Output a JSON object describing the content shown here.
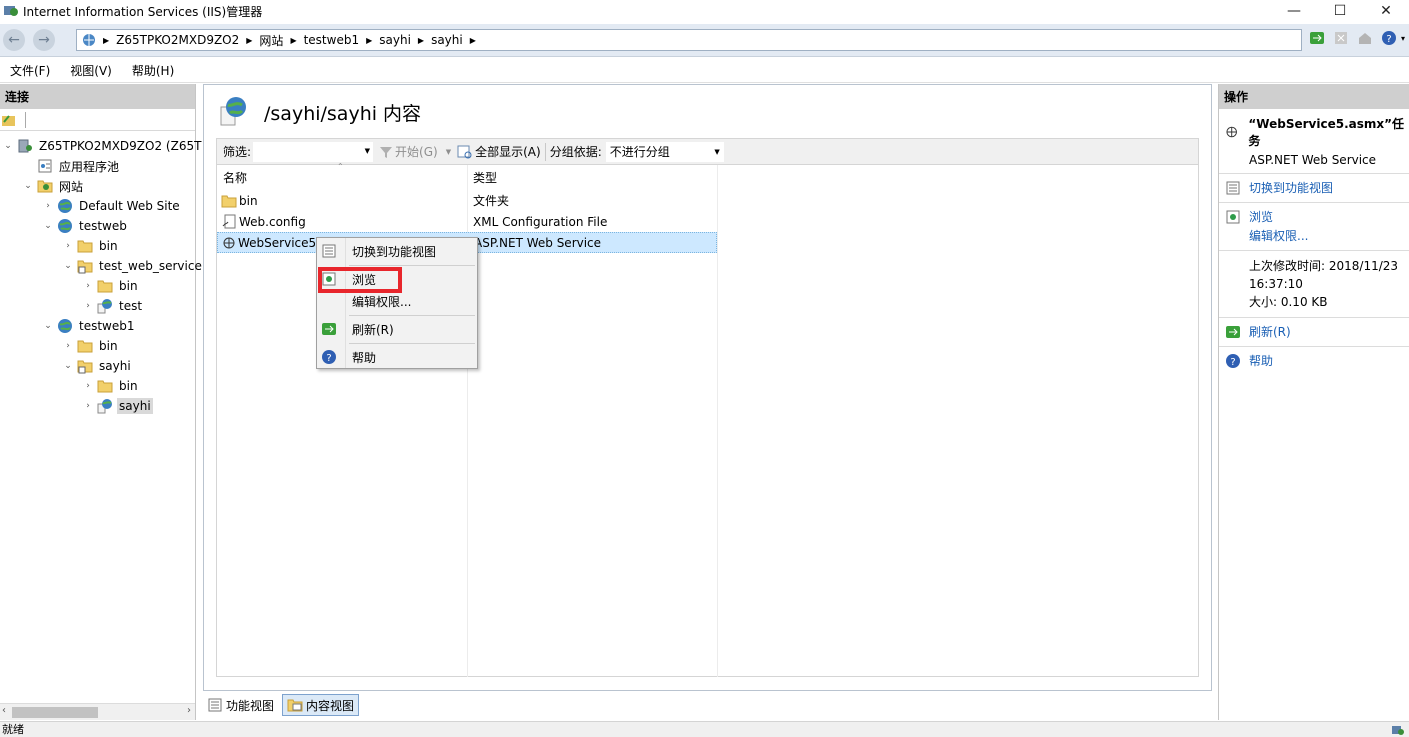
{
  "window": {
    "title": "Internet Information Services (IIS)管理器",
    "controls": {
      "minimize": "—",
      "maximize": "☐",
      "close": "✕"
    }
  },
  "address": {
    "segments": [
      "Z65TPKO2MXD9ZO2",
      "网站",
      "testweb1",
      "sayhi",
      "sayhi"
    ]
  },
  "menubar": {
    "items": [
      "文件(F)",
      "视图(V)",
      "帮助(H)"
    ]
  },
  "left_panel": {
    "header": "连接",
    "tree": [
      {
        "label": "Z65TPKO2MXD9ZO2 (Z65T",
        "icon": "server-icon",
        "expander": "⌄"
      },
      {
        "label": "应用程序池",
        "icon": "app-pool-icon",
        "expander": ""
      },
      {
        "label": "网站",
        "icon": "sites-folder-icon",
        "expander": "⌄"
      },
      {
        "label": "Default Web Site",
        "icon": "globe-icon",
        "expander": "›"
      },
      {
        "label": "testweb",
        "icon": "globe-icon",
        "expander": "⌄"
      },
      {
        "label": "bin",
        "icon": "folder-icon",
        "expander": "›"
      },
      {
        "label": "test_web_service",
        "icon": "app-folder-icon",
        "expander": "⌄"
      },
      {
        "label": "bin",
        "icon": "folder-icon",
        "expander": "›"
      },
      {
        "label": "test",
        "icon": "web-app-icon",
        "expander": "›"
      },
      {
        "label": "testweb1",
        "icon": "globe-icon",
        "expander": "⌄"
      },
      {
        "label": "bin",
        "icon": "folder-icon",
        "expander": "›"
      },
      {
        "label": "sayhi",
        "icon": "app-folder-icon",
        "expander": "⌄"
      },
      {
        "label": "bin",
        "icon": "folder-icon",
        "expander": "›"
      },
      {
        "label": "sayhi",
        "icon": "web-app-icon",
        "expander": "›"
      }
    ]
  },
  "center": {
    "title": "/sayhi/sayhi 内容",
    "filter": {
      "label": "筛选:",
      "start": "开始(G)",
      "show_all": "全部显示(A)",
      "group_label": "分组依据:",
      "group_value": "不进行分组"
    },
    "columns": [
      "名称",
      "类型"
    ],
    "rows": [
      {
        "name": "bin",
        "type": "文件夹",
        "icon": "folder-icon"
      },
      {
        "name": "Web.config",
        "type": "XML Configuration File",
        "icon": "config-file-icon"
      },
      {
        "name": "WebService5.",
        "type": "ASP.NET Web Service",
        "icon": "web-service-icon"
      }
    ],
    "tabs": [
      "功能视图",
      "内容视图"
    ]
  },
  "context_menu": {
    "items": [
      "切换到功能视图",
      "浏览",
      "编辑权限...",
      "刷新(R)",
      "帮助"
    ]
  },
  "right_panel": {
    "header": "操作",
    "task_title": "“WebService5.asmx”任务",
    "task_sub": "ASP.NET Web Service",
    "switch_view": "切换到功能视图",
    "browse": "浏览",
    "edit_perms": "编辑权限...",
    "modified_label": "上次修改时间: 2018/11/23",
    "modified_time": "16:37:10",
    "size": "大小: 0.10 KB",
    "refresh": "刷新(R)",
    "help": "帮助"
  },
  "status": {
    "text": "就绪"
  },
  "colors": {
    "highlight_box": "#e8262c",
    "link": "#1a5fb4",
    "selection": "#cde8ff"
  }
}
